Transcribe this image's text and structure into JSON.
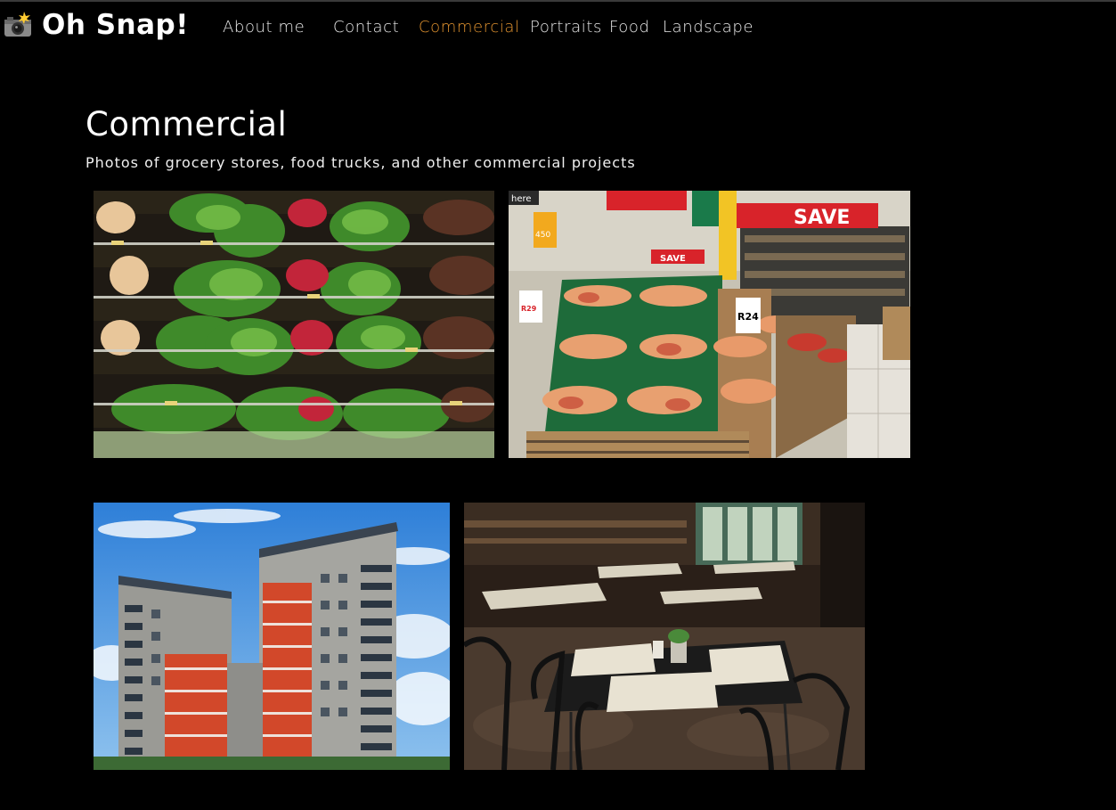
{
  "brand": {
    "name": "Oh Snap!",
    "logo_icon": "camera-flash-icon"
  },
  "nav": {
    "items": [
      {
        "label": "About me",
        "active": false
      },
      {
        "label": "Contact",
        "active": false
      },
      {
        "label": "Commercial",
        "active": true
      },
      {
        "label": "Portraits",
        "active": false
      },
      {
        "label": "Food",
        "active": false
      },
      {
        "label": "Landscape",
        "active": false
      }
    ],
    "active_color": "#e0922f"
  },
  "page": {
    "title": "Commercial",
    "subtitle": "Photos of grocery stores, food trucks, and other commercial projects"
  },
  "gallery": {
    "signs": {
      "save": "SAVE",
      "price1": "R24",
      "price2": "R29",
      "price3": "450",
      "here": "here"
    }
  },
  "colors": {
    "background": "#000000",
    "text": "#ffffff",
    "accent": "#e0922f"
  }
}
